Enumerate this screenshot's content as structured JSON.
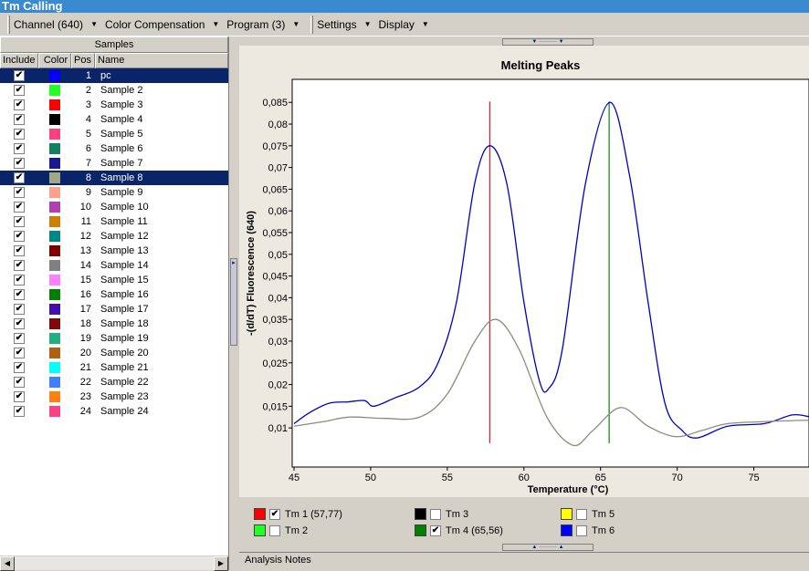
{
  "window": {
    "title": "Tm Calling"
  },
  "toolbar": {
    "items": [
      "Channel (640)",
      "Color Compensation",
      "Program (3)",
      "Settings",
      "Display"
    ]
  },
  "samples": {
    "header": "Samples",
    "columns": [
      "Include",
      "Color",
      "Pos",
      "Name"
    ],
    "rows": [
      {
        "pos": "1",
        "name": "pc",
        "color": "#0000ff",
        "include": true,
        "selected": true
      },
      {
        "pos": "2",
        "name": "Sample 2",
        "color": "#22ff22",
        "include": true
      },
      {
        "pos": "3",
        "name": "Sample 3",
        "color": "#ff0000",
        "include": true
      },
      {
        "pos": "4",
        "name": "Sample 4",
        "color": "#000000",
        "include": true
      },
      {
        "pos": "5",
        "name": "Sample 5",
        "color": "#ff4080",
        "include": true
      },
      {
        "pos": "6",
        "name": "Sample 6",
        "color": "#108060",
        "include": true
      },
      {
        "pos": "7",
        "name": "Sample 7",
        "color": "#1a1a90",
        "include": true
      },
      {
        "pos": "8",
        "name": "Sample 8",
        "color": "#a0a888",
        "include": true,
        "selected": true
      },
      {
        "pos": "9",
        "name": "Sample 9",
        "color": "#ffa088",
        "include": true
      },
      {
        "pos": "10",
        "name": "Sample 10",
        "color": "#b040b0",
        "include": true
      },
      {
        "pos": "11",
        "name": "Sample 11",
        "color": "#d08000",
        "include": true
      },
      {
        "pos": "12",
        "name": "Sample 12",
        "color": "#008888",
        "include": true
      },
      {
        "pos": "13",
        "name": "Sample 13",
        "color": "#800000",
        "include": true
      },
      {
        "pos": "14",
        "name": "Sample 14",
        "color": "#808080",
        "include": true
      },
      {
        "pos": "15",
        "name": "Sample 15",
        "color": "#ff80ff",
        "include": true
      },
      {
        "pos": "16",
        "name": "Sample 16",
        "color": "#008000",
        "include": true
      },
      {
        "pos": "17",
        "name": "Sample 17",
        "color": "#4010a8",
        "include": true
      },
      {
        "pos": "18",
        "name": "Sample 18",
        "color": "#800808",
        "include": true
      },
      {
        "pos": "19",
        "name": "Sample 19",
        "color": "#20b080",
        "include": true
      },
      {
        "pos": "20",
        "name": "Sample 20",
        "color": "#b06010",
        "include": true
      },
      {
        "pos": "21",
        "name": "Sample 21",
        "color": "#00ffff",
        "include": true
      },
      {
        "pos": "22",
        "name": "Sample 22",
        "color": "#4080ff",
        "include": true
      },
      {
        "pos": "23",
        "name": "Sample 23",
        "color": "#ff8010",
        "include": true
      },
      {
        "pos": "24",
        "name": "Sample 24",
        "color": "#ff4088",
        "include": true
      }
    ]
  },
  "chart_data": {
    "type": "line",
    "title": "Melting Peaks",
    "xlabel": "Temperature (°C)",
    "ylabel": "-(d/dT) Fluorescence (640)",
    "xlim": [
      45,
      78.6
    ],
    "ylim": [
      0.001,
      0.0903
    ],
    "xticks": [
      45,
      50,
      55,
      60,
      65,
      70,
      75
    ],
    "yticks": [
      "0,01",
      "0,015",
      "0,02",
      "0,025",
      "0,03",
      "0,035",
      "0,04",
      "0,045",
      "0,05",
      "0,055",
      "0,06",
      "0,065",
      "0,07",
      "0,075",
      "0,08",
      "0,085"
    ],
    "series": [
      {
        "color": "#0000c0",
        "points": [
          [
            45,
            0.011
          ],
          [
            46,
            0.0135
          ],
          [
            47.3,
            0.0157
          ],
          [
            48.5,
            0.016
          ],
          [
            49.6,
            0.0163
          ],
          [
            50.2,
            0.015
          ],
          [
            51.5,
            0.0168
          ],
          [
            53.2,
            0.0195
          ],
          [
            54.4,
            0.025
          ],
          [
            55.6,
            0.039
          ],
          [
            56.8,
            0.0665
          ],
          [
            57.8,
            0.075
          ],
          [
            58.9,
            0.066
          ],
          [
            60,
            0.039
          ],
          [
            61,
            0.021
          ],
          [
            61.6,
            0.019
          ],
          [
            62.5,
            0.028
          ],
          [
            64,
            0.066
          ],
          [
            65.6,
            0.085
          ],
          [
            66.9,
            0.068
          ],
          [
            68.1,
            0.039
          ],
          [
            69.2,
            0.0157
          ],
          [
            70.3,
            0.0095
          ],
          [
            71.3,
            0.0077
          ],
          [
            73.3,
            0.0104
          ],
          [
            75.7,
            0.011
          ],
          [
            77.5,
            0.013
          ],
          [
            78.6,
            0.0126
          ]
        ]
      },
      {
        "color": "#8c8c7c",
        "points": [
          [
            45,
            0.0104
          ],
          [
            47,
            0.0115
          ],
          [
            48.6,
            0.0125
          ],
          [
            50.9,
            0.0122
          ],
          [
            53.2,
            0.0125
          ],
          [
            55,
            0.0178
          ],
          [
            56.8,
            0.03
          ],
          [
            58.2,
            0.035
          ],
          [
            59.7,
            0.028
          ],
          [
            61.5,
            0.0125
          ],
          [
            63.2,
            0.006
          ],
          [
            64.5,
            0.0094
          ],
          [
            66.3,
            0.0147
          ],
          [
            68.1,
            0.0104
          ],
          [
            69.9,
            0.008
          ],
          [
            71.6,
            0.0094
          ],
          [
            73.3,
            0.011
          ],
          [
            76,
            0.0115
          ],
          [
            78.6,
            0.0118
          ]
        ]
      }
    ],
    "tm_lines": [
      {
        "x": 57.77,
        "color": "#d02020"
      },
      {
        "x": 65.56,
        "color": "#108010"
      }
    ],
    "grid": false
  },
  "tm_legend": [
    {
      "label": "Tm 1 (57,77)",
      "color": "#ff0000",
      "checked": true
    },
    {
      "label": "Tm 2",
      "color": "#22ff22",
      "checked": false
    },
    {
      "label": "Tm 3",
      "color": "#000000",
      "checked": false
    },
    {
      "label": "Tm 4 (65,56)",
      "color": "#008000",
      "checked": true
    },
    {
      "label": "Tm 5",
      "color": "#ffff00",
      "checked": false
    },
    {
      "label": "Tm 6",
      "color": "#0000ff",
      "checked": false
    }
  ],
  "notes": {
    "label": "Analysis Notes"
  }
}
